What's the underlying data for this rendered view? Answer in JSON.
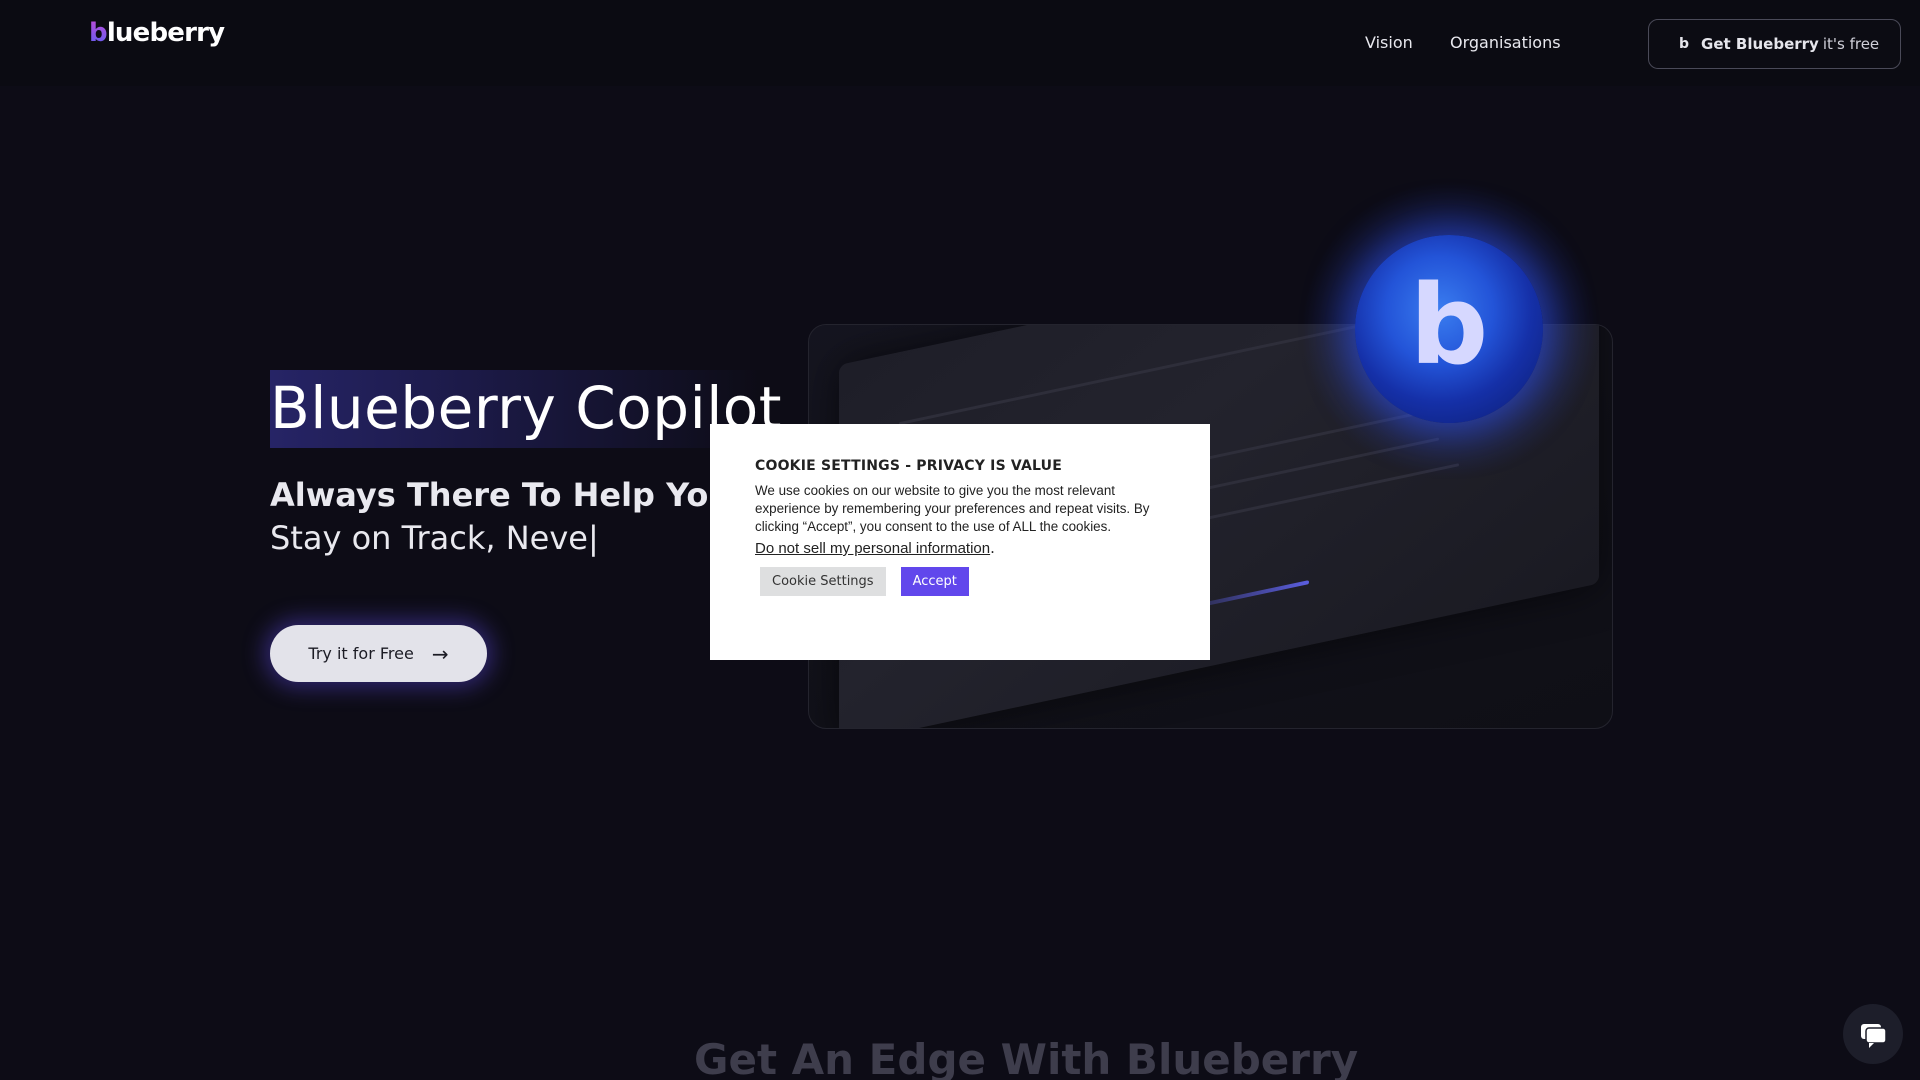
{
  "header": {
    "logo_first": "b",
    "logo_rest": "lueberry",
    "nav": [
      "Vision",
      "Organisations"
    ],
    "cta": {
      "mark": "b",
      "strong": "Get Blueberry",
      "light": "it's free"
    }
  },
  "hero": {
    "title": "Blueberry Copilot",
    "subtitle": "Always There To Help You",
    "typing": "Stay on Track, Neve|",
    "cta_label": "Try it for Free",
    "cta_arrow": "→"
  },
  "orb": {
    "letter": "b"
  },
  "cookie": {
    "title": "COOKIE SETTINGS - PRIVACY IS VALUE",
    "body": "We use cookies on our website to give you the most relevant experience by remembering your preferences and repeat visits. By clicking “Accept”, you consent to the use of ALL the cookies.",
    "link": "Do not sell my personal information",
    "link_suffix": ".",
    "settings_label": "Cookie Settings",
    "accept_label": "Accept"
  },
  "section2": {
    "title": "Get An Edge With Blueberry"
  },
  "icons": {
    "chat": "chat-bubble-icon",
    "arrow": "arrow-right-icon"
  },
  "colors": {
    "accent": "#6147ec",
    "background": "#0d0c16",
    "orb": "#2354d8"
  }
}
